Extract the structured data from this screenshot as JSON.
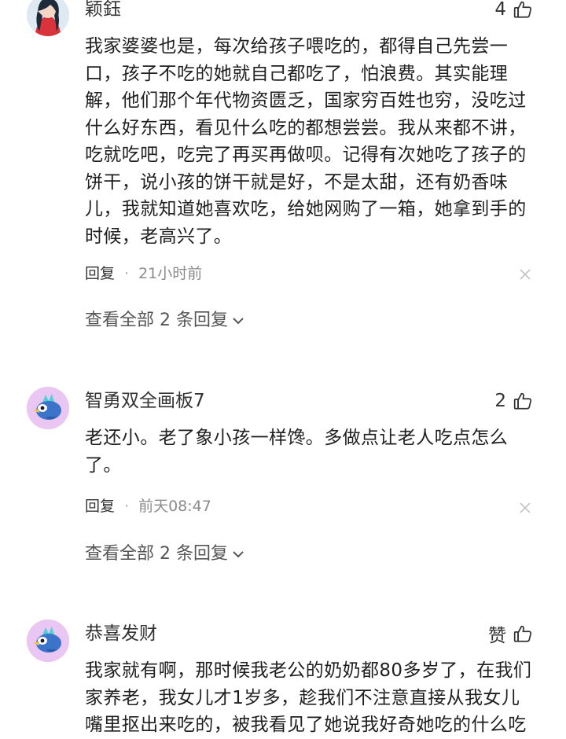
{
  "comments": [
    {
      "username": "颖鈺",
      "likes": "4",
      "text": "我家婆婆也是，每次给孩子喂吃的，都得自己先尝一\n口，孩子不吃的她就自己都吃了，怕浪费。其实能理\n解，他们那个年代物资匮乏，国家穷百姓也穷，没吃过\n什么好东西，看见什么吃的都想尝尝。我从来都不讲，\n吃就吃吧，吃完了再买再做呗。记得有次她吃了孩子的\n饼干，说小孩的饼干就是好，不是太甜，还有奶香味\n儿，我就知道她喜欢吃，给她网购了一箱，她拿到手的\n时候，老高兴了。",
      "reply_label": "回复",
      "dot": "·",
      "time": "21小时前",
      "view_replies": "查看全部 2 条回复"
    },
    {
      "username": "智勇双全画板7",
      "likes": "2",
      "text": "老还小。老了象小孩一样馋。多做点让老人吃点怎么\n了。",
      "reply_label": "回复",
      "dot": "·",
      "time": "前天08:47",
      "view_replies": "查看全部 2 条回复"
    },
    {
      "username": "恭喜发财",
      "likes": "赞",
      "text": "我家就有啊，那时候我老公的奶奶都80多岁了，在我们\n家养老，我女儿才1岁多，趁我们不注意直接从我女儿\n嘴里抠出来吃的，被我看见了她说我好奇她吃的什么吃"
    }
  ],
  "icons": {
    "like": "thumbs-up-icon",
    "close": "close-icon",
    "chevron": "chevron-down-icon"
  },
  "colors": {
    "text": "#1f1f1f",
    "meta": "#8c8c8c",
    "avatar_bg": "#e9c7f2",
    "bird_blue": "#3b74c9"
  }
}
